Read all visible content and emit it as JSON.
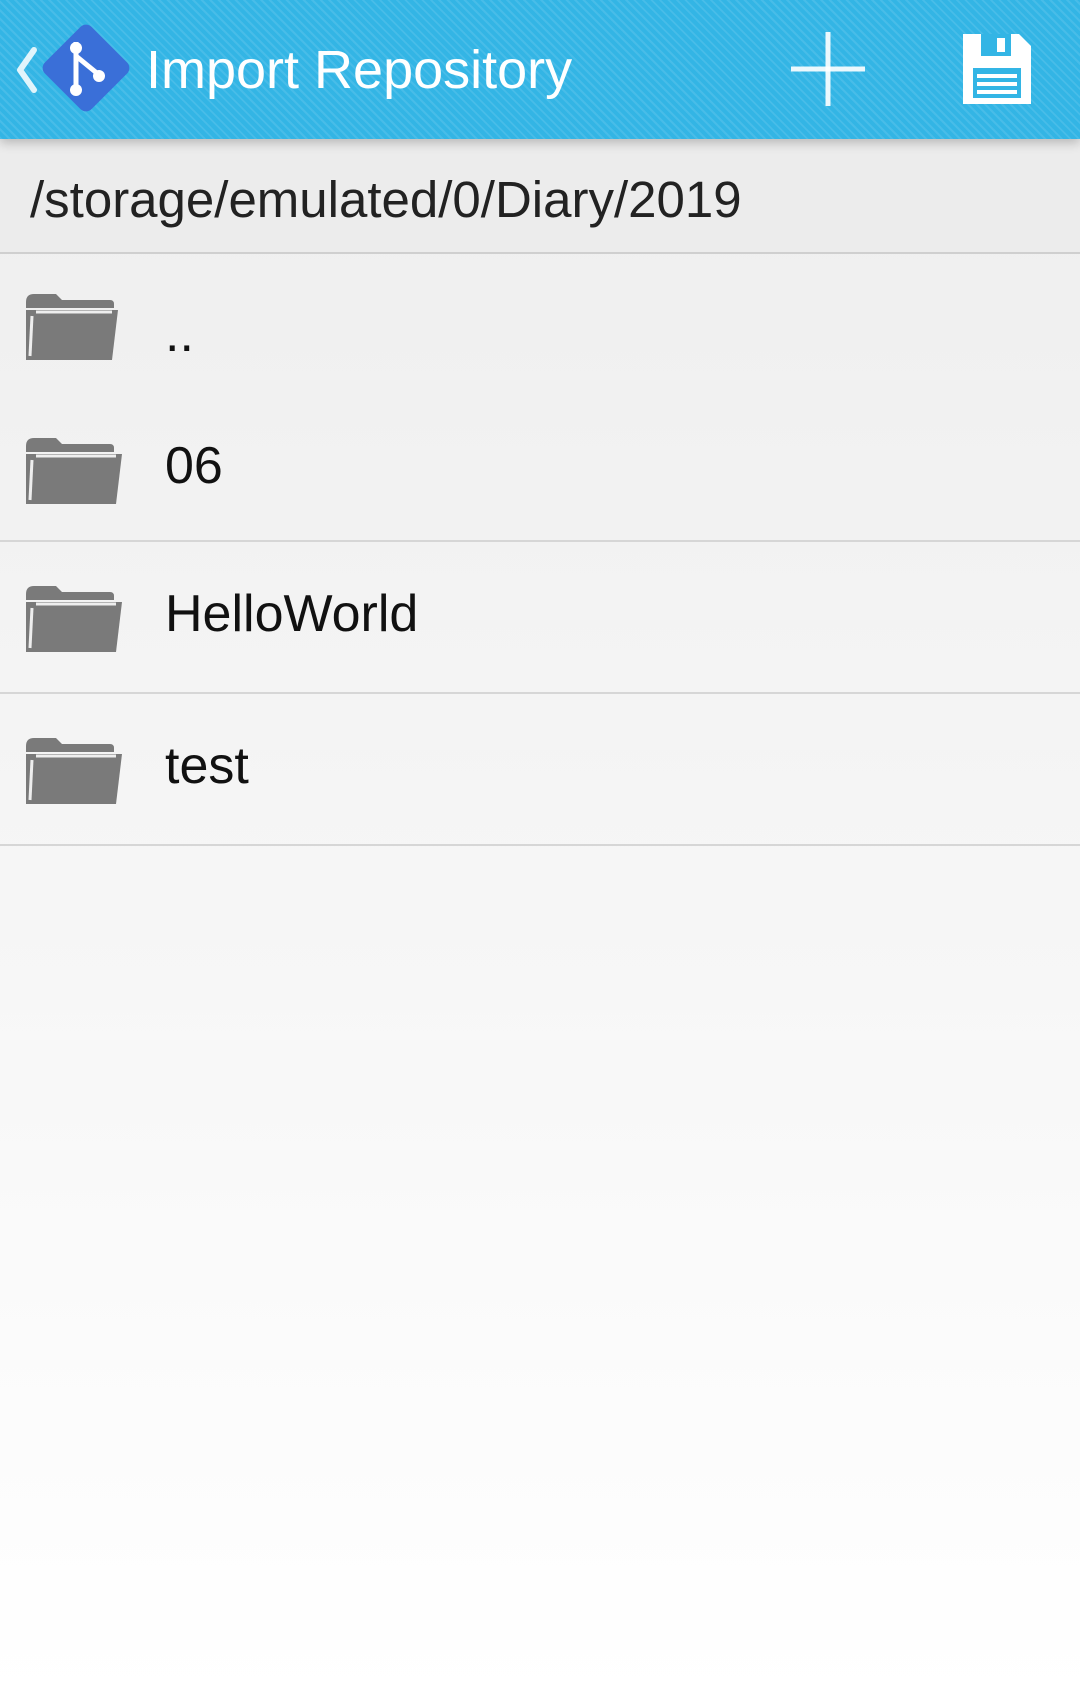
{
  "colors": {
    "action_bar": "#33b5e5",
    "logo": "#3a6fd8",
    "icon_white": "#ffffff",
    "folder_icon": "#7a7a7a",
    "list_divider": "#d6d6d6"
  },
  "action_bar": {
    "up_icon": "chevron-left-icon",
    "logo_icon": "git-logo-icon",
    "title": "Import Repository",
    "actions": [
      {
        "name": "add",
        "icon": "plus-icon"
      },
      {
        "name": "save",
        "icon": "floppy-disk-icon"
      }
    ]
  },
  "browser": {
    "current_path": "/storage/emulated/0/Diary/2019",
    "items": [
      {
        "label": "..",
        "icon": "folder-icon"
      },
      {
        "label": "06",
        "icon": "folder-icon"
      },
      {
        "label": "HelloWorld",
        "icon": "folder-icon"
      },
      {
        "label": "test",
        "icon": "folder-icon"
      }
    ]
  }
}
